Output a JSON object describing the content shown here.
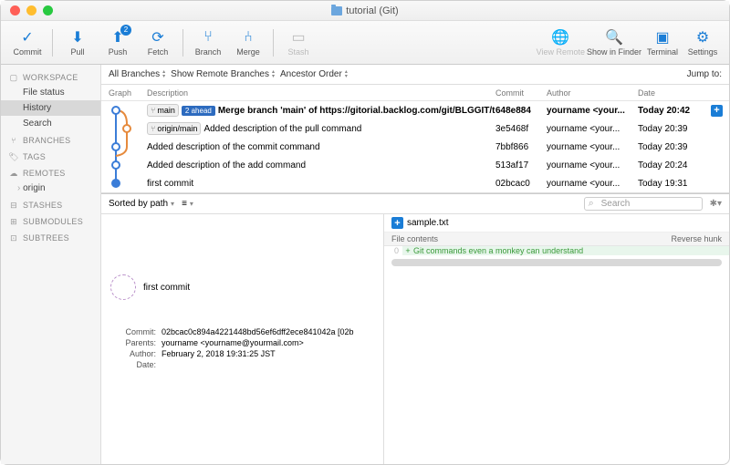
{
  "window": {
    "title": "tutorial (Git)"
  },
  "toolbar": {
    "commit": "Commit",
    "pull": "Pull",
    "push": "Push",
    "fetch": "Fetch",
    "branch": "Branch",
    "merge": "Merge",
    "stash": "Stash",
    "viewremote": "View Remote",
    "showfinder": "Show in Finder",
    "terminal": "Terminal",
    "settings": "Settings",
    "push_badge": "2"
  },
  "sidebar": {
    "sections": [
      {
        "name": "WORKSPACE",
        "items": [
          "File status",
          "History",
          "Search"
        ],
        "selected": 1
      },
      {
        "name": "BRANCHES",
        "items": []
      },
      {
        "name": "TAGS",
        "items": []
      },
      {
        "name": "REMOTES",
        "items": [
          "origin"
        ]
      },
      {
        "name": "STASHES",
        "items": []
      },
      {
        "name": "SUBMODULES",
        "items": []
      },
      {
        "name": "SUBTREES",
        "items": []
      }
    ]
  },
  "filters": {
    "branches": "All Branches",
    "remote": "Show Remote Branches",
    "order": "Ancestor Order",
    "jump": "Jump to:"
  },
  "headers": {
    "graph": "Graph",
    "desc": "Description",
    "commit": "Commit",
    "author": "Author",
    "date": "Date"
  },
  "commits": [
    {
      "refs": [
        {
          "t": "main",
          "ahead": "2 ahead"
        }
      ],
      "msg": "Merge branch 'main' of https://gitorial.backlog.com/git/BLGGIT/tutorial",
      "hash": "648e884",
      "author": "yourname <your...",
      "date": "Today 20:42",
      "sel": true
    },
    {
      "refs": [
        {
          "t": "origin/main"
        }
      ],
      "msg": "Added description of the pull command",
      "hash": "3e5468f",
      "author": "yourname <your...",
      "date": "Today 20:39"
    },
    {
      "msg": "Added description of the commit command",
      "hash": "7bbf866",
      "author": "yourname <your...",
      "date": "Today 20:39"
    },
    {
      "msg": "Added description of the add command",
      "hash": "513af17",
      "author": "yourname <your...",
      "date": "Today 20:24"
    },
    {
      "msg": "first commit",
      "hash": "02bcac0",
      "author": "yourname <your...",
      "date": "Today 19:31"
    }
  ],
  "lowerbar": {
    "sort": "Sorted by path",
    "search_ph": "Search"
  },
  "file": {
    "name": "sample.txt",
    "section": "File contents",
    "reverse": "Reverse hunk",
    "line_no": "0",
    "line": "Git commands even a monkey can understand"
  },
  "detail": {
    "subject": "first commit",
    "labels": {
      "commit": "Commit:",
      "parents": "Parents:",
      "author": "Author:",
      "date": "Date:"
    },
    "commit": "02bcac0c894a4221448bd56ef6dff2ece841042a [02b",
    "parents": "yourname <yourname@yourmail.com>",
    "author": "February 2, 2018 19:31:25 JST",
    "date": ""
  }
}
